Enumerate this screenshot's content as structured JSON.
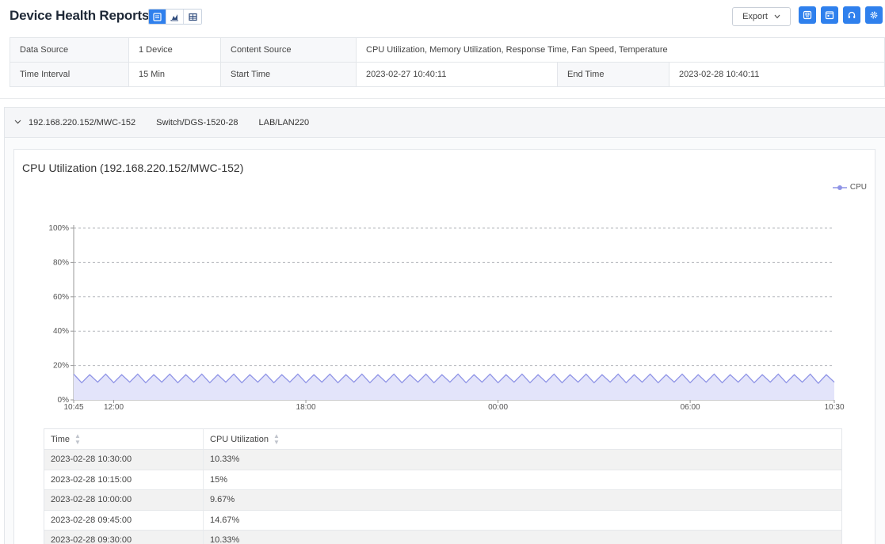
{
  "header": {
    "title": "Device Health Reports",
    "view_modes": [
      {
        "name": "report-view-icon",
        "active": true
      },
      {
        "name": "chart-view-icon",
        "active": false
      },
      {
        "name": "table-view-icon",
        "active": false
      }
    ],
    "export_label": "Export",
    "action_icons": [
      "save-icon",
      "schedule-icon",
      "headset-icon",
      "settings-icon"
    ]
  },
  "info": {
    "data_source_label": "Data Source",
    "data_source_value": "1 Device",
    "content_source_label": "Content Source",
    "content_source_value": "CPU Utilization, Memory Utilization, Response Time, Fan Speed, Temperature",
    "time_interval_label": "Time Interval",
    "time_interval_value": "15 Min",
    "start_time_label": "Start Time",
    "start_time_value": "2023-02-27 10:40:11",
    "end_time_label": "End Time",
    "end_time_value": "2023-02-28 10:40:11"
  },
  "device": {
    "address": "192.168.220.152/MWC-152",
    "model": "Switch/DGS-1520-28",
    "location": "LAB/LAN220"
  },
  "colors": {
    "accent": "#2f80ed",
    "series_line": "#8f94e6",
    "series_fill": "#e3e4fa"
  },
  "chart_data": {
    "type": "area",
    "title": "CPU Utilization (192.168.220.152/MWC-152)",
    "series_name": "CPU",
    "y_ticks": [
      "100%",
      "80%",
      "60%",
      "40%",
      "20%",
      "0%"
    ],
    "ylim": [
      0,
      100
    ],
    "x_ticks": [
      {
        "time": "10:45",
        "date": "02-27",
        "hour": 0
      },
      {
        "time": "12:00",
        "date": "02-27",
        "hour": 1.25
      },
      {
        "time": "18:00",
        "date": "02-27",
        "hour": 7.25
      },
      {
        "time": "00:00",
        "date": "02-28",
        "hour": 13.25
      },
      {
        "time": "06:00",
        "date": "02-28",
        "hour": 19.25
      },
      {
        "time": "10:30",
        "date": "02-28",
        "hour": 23.75
      }
    ],
    "grid": "dashed-horizontal",
    "legend": "top-right",
    "values": [
      15,
      10,
      14.67,
      10.33,
      15,
      10,
      14.67,
      10.33,
      15,
      10,
      14.67,
      10.33,
      15,
      10,
      14.67,
      10.33,
      15,
      10,
      14.67,
      10.33,
      15,
      10,
      14.67,
      10.33,
      15,
      10,
      14.67,
      10.33,
      15,
      10,
      14.67,
      10.33,
      15,
      10,
      14.67,
      10.33,
      15,
      10,
      14.67,
      10.33,
      15,
      10,
      14.67,
      10.33,
      15,
      10,
      14.67,
      10.33,
      15,
      10,
      14.67,
      10.33,
      15,
      10,
      14.67,
      10.33,
      15,
      10,
      14.67,
      10.33,
      15,
      10,
      14.67,
      10.33,
      15,
      10,
      14.67,
      10.33,
      15,
      10,
      14.67,
      10.33,
      15,
      10,
      14.67,
      10.33,
      15,
      10,
      14.67,
      10.33,
      15,
      10,
      14.67,
      10.33,
      15,
      10,
      14.67,
      10.33,
      15,
      10,
      14.67,
      10.33,
      15,
      9.67,
      14.67,
      10.33
    ]
  },
  "table": {
    "columns": [
      "Time",
      "CPU Utilization"
    ],
    "rows": [
      [
        "2023-02-28 10:30:00",
        "10.33%"
      ],
      [
        "2023-02-28 10:15:00",
        "15%"
      ],
      [
        "2023-02-28 10:00:00",
        "9.67%"
      ],
      [
        "2023-02-28 09:45:00",
        "14.67%"
      ],
      [
        "2023-02-28 09:30:00",
        "10.33%"
      ]
    ]
  }
}
